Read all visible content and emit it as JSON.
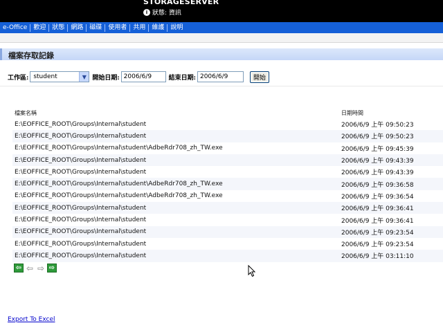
{
  "header": {
    "server_name": "STORAGESERVER",
    "status_text": "狀態: 資訊",
    "status_icon": "info-icon"
  },
  "nav": {
    "items": [
      "e-Office",
      "歡迎",
      "狀態",
      "網路",
      "磁碟",
      "使用者",
      "共用",
      "維護",
      "說明"
    ]
  },
  "page": {
    "title": "檔案存取記錄"
  },
  "filter": {
    "workgroup_label": "工作區:",
    "workgroup_value": "student",
    "start_label": "開始日期:",
    "start_value": "2006/6/9",
    "end_label": "結束日期:",
    "end_value": "2006/6/9",
    "go_label": "開始"
  },
  "table": {
    "headers": [
      "檔案名稱",
      "日期時間"
    ],
    "rows": [
      {
        "file": "E:\\EOFFICE_ROOT\\Groups\\Internal\\student",
        "datetime": "2006/6/9 上午 09:50:23"
      },
      {
        "file": "E:\\EOFFICE_ROOT\\Groups\\Internal\\student",
        "datetime": "2006/6/9 上午 09:50:23"
      },
      {
        "file": "E:\\EOFFICE_ROOT\\Groups\\Internal\\student\\AdbeRdr708_zh_TW.exe",
        "datetime": "2006/6/9 上午 09:45:39"
      },
      {
        "file": "E:\\EOFFICE_ROOT\\Groups\\Internal\\student",
        "datetime": "2006/6/9 上午 09:43:39"
      },
      {
        "file": "E:\\EOFFICE_ROOT\\Groups\\Internal\\student",
        "datetime": "2006/6/9 上午 09:43:39"
      },
      {
        "file": "E:\\EOFFICE_ROOT\\Groups\\Internal\\student\\AdbeRdr708_zh_TW.exe",
        "datetime": "2006/6/9 上午 09:36:58"
      },
      {
        "file": "E:\\EOFFICE_ROOT\\Groups\\Internal\\student\\AdbeRdr708_zh_TW.exe",
        "datetime": "2006/6/9 上午 09:36:54"
      },
      {
        "file": "E:\\EOFFICE_ROOT\\Groups\\Internal\\student",
        "datetime": "2006/6/9 上午 09:36:41"
      },
      {
        "file": "E:\\EOFFICE_ROOT\\Groups\\Internal\\student",
        "datetime": "2006/6/9 上午 09:36:41"
      },
      {
        "file": "E:\\EOFFICE_ROOT\\Groups\\Internal\\student",
        "datetime": "2006/6/9 上午 09:23:54"
      },
      {
        "file": "E:\\EOFFICE_ROOT\\Groups\\Internal\\student",
        "datetime": "2006/6/9 上午 09:23:54"
      },
      {
        "file": "E:\\EOFFICE_ROOT\\Groups\\Internal\\student",
        "datetime": "2006/6/9 上午 03:11:10"
      }
    ]
  },
  "pager": {
    "first_icon": "first-page-icon",
    "prev_icon": "prev-page-icon",
    "next_icon": "next-page-icon",
    "last_icon": "last-page-icon"
  },
  "footer": {
    "export_label": "Export To Excel"
  },
  "colors": {
    "navbar": "#1560d8",
    "title_bar": "#c5d7f7",
    "pager_green": "#2e9a3a",
    "link": "#0000cc"
  }
}
